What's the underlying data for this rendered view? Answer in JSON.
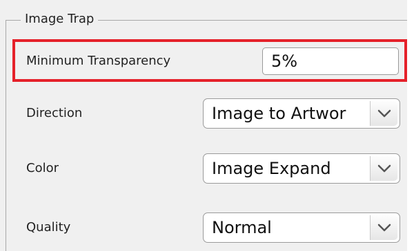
{
  "group": {
    "title": "Image Trap"
  },
  "fields": {
    "minimum_transparency": {
      "label": "Minimum Transparency",
      "value": "5%"
    },
    "direction": {
      "label": "Direction",
      "value": "Image to Artwor"
    },
    "color": {
      "label": "Color",
      "value": "Image Expand"
    },
    "quality": {
      "label": "Quality",
      "value": "Normal"
    }
  },
  "icons": {
    "dropdown": "chevron-down-icon"
  },
  "colors": {
    "highlight": "#e5212a",
    "panel_background": "#f0f0f0"
  }
}
